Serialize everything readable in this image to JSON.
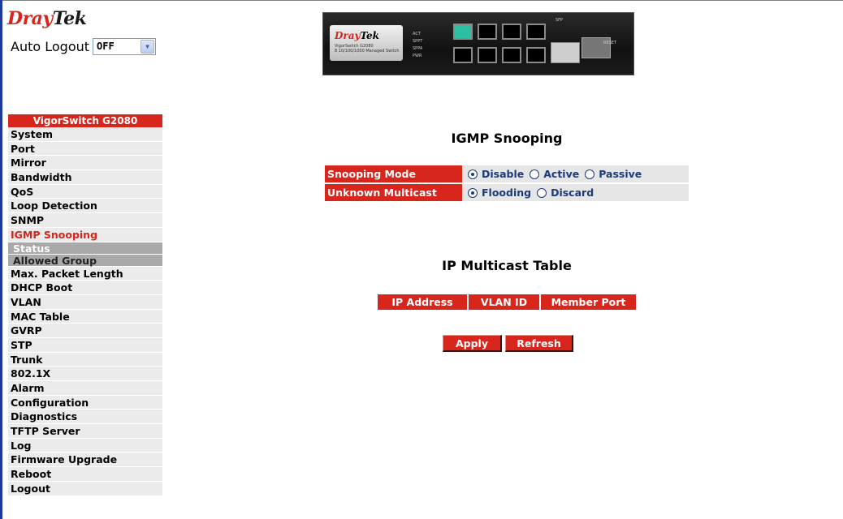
{
  "brand": {
    "dray": "Dray",
    "tek": "Tek"
  },
  "auto_logout": {
    "label": "Auto Logout",
    "value": "OFF"
  },
  "device_image": {
    "brand": "DrayTek",
    "model_line1": "VigorSwitch G2080",
    "model_line2": "8 10/100/1000 Managed Switch",
    "led_labels": [
      "ACT",
      "SPPT",
      "SPPA",
      "PWR"
    ],
    "sfp_label": "SFP",
    "reset_label": "RESET"
  },
  "sidebar": {
    "title": "VigorSwitch G2080",
    "items": [
      {
        "label": "System"
      },
      {
        "label": "Port"
      },
      {
        "label": "Mirror"
      },
      {
        "label": "Bandwidth"
      },
      {
        "label": "QoS"
      },
      {
        "label": "Loop Detection"
      },
      {
        "label": "SNMP"
      },
      {
        "label": "IGMP Snooping"
      },
      {
        "label": "Max. Packet Length"
      },
      {
        "label": "DHCP Boot"
      },
      {
        "label": "VLAN"
      },
      {
        "label": "MAC Table"
      },
      {
        "label": "GVRP"
      },
      {
        "label": "STP"
      },
      {
        "label": "Trunk"
      },
      {
        "label": "802.1X"
      },
      {
        "label": "Alarm"
      },
      {
        "label": "Configuration"
      },
      {
        "label": "Diagnostics"
      },
      {
        "label": "TFTP Server"
      },
      {
        "label": "Log"
      },
      {
        "label": "Firmware Upgrade"
      },
      {
        "label": "Reboot"
      },
      {
        "label": "Logout"
      }
    ],
    "subitems": {
      "status": "Status",
      "allowed_group": "Allowed Group"
    }
  },
  "main": {
    "snooping_title": "IGMP Snooping",
    "snooping_mode": {
      "label": "Snooping Mode",
      "options": [
        "Disable",
        "Active",
        "Passive"
      ],
      "selected": "Disable"
    },
    "unknown_multicast": {
      "label": "Unknown Multicast",
      "options": [
        "Flooding",
        "Discard"
      ],
      "selected": "Flooding"
    },
    "multicast_title": "IP Multicast Table",
    "table_headers": [
      "IP Address",
      "VLAN ID",
      "Member Port"
    ],
    "apply_label": "Apply",
    "refresh_label": "Refresh"
  },
  "colors": {
    "accent": "#d8261c",
    "nav_bg": "#ebebeb",
    "value_bg": "#e6e6e6",
    "radio_text": "#1b3b7a"
  }
}
